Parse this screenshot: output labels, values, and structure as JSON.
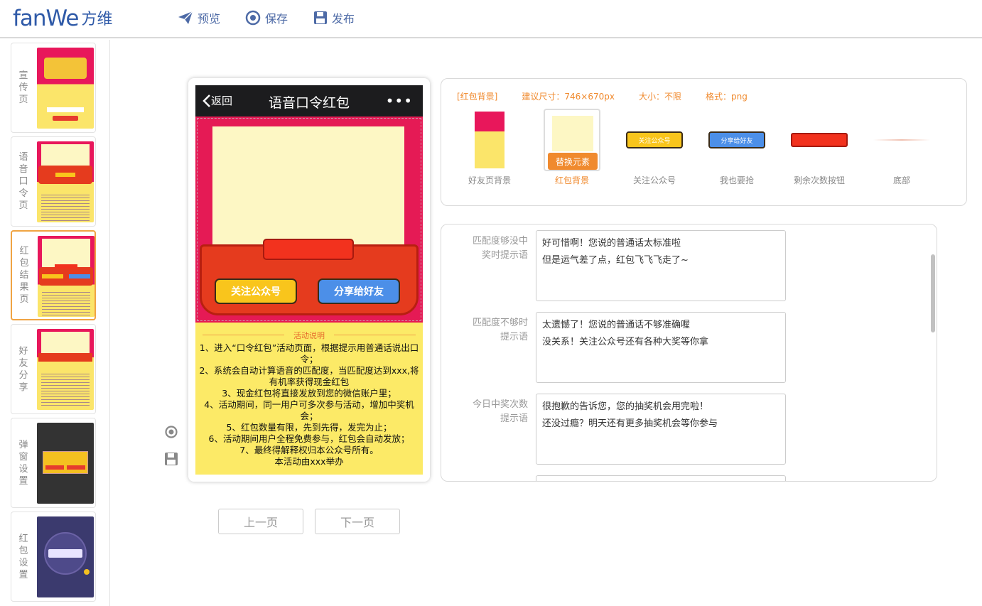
{
  "app": {
    "logo_en": "fanWe",
    "logo_cn": "方维"
  },
  "toolbar": {
    "preview": "预览",
    "save": "保存",
    "publish": "发布"
  },
  "sidebar": {
    "pages": [
      {
        "label": "宣\n传\n页"
      },
      {
        "label": "语\n音\n口\n令\n页"
      },
      {
        "label": "红\n包\n结\n果\n页"
      },
      {
        "label": "好\n友\n分\n享"
      },
      {
        "label": "弹\n窗\n设\n置"
      },
      {
        "label": "红\n包\n设\n置"
      }
    ]
  },
  "phone": {
    "back": "返回",
    "title": "语音口令红包",
    "more": "•••",
    "follow_btn": "关注公众号",
    "share_btn": "分享给好友",
    "rules_title": "活动说明",
    "rules": [
      "1、进入“口令红包”活动页面，根据提示用普通话说出口令；",
      "2、系统会自动计算语音的匹配度，当匹配度达到xxx,将有机率获得现金红包",
      "3、现金红包将直接发放到您的微信账户里；",
      "4、活动期间，同一用户可多次参与活动，增加中奖机会；",
      "5、红包数量有限，先到先得，发完为止；",
      "6、活动期间用户全程免费参与，红包会自动发放；",
      "7、最终得解释权归本公众号所有。",
      "本活动由xxx举办"
    ]
  },
  "nav": {
    "prev": "上一页",
    "next": "下一页"
  },
  "assets": {
    "info": {
      "tag": "[红包背景]",
      "size": "建议尺寸：746×670px",
      "filesize": "大小：不限",
      "format": "格式：png"
    },
    "replace_label": "替换元素",
    "items": [
      {
        "caption": "好友页背景"
      },
      {
        "caption": "红包背景"
      },
      {
        "caption": "关注公众号",
        "btn_text": "关注公众号"
      },
      {
        "caption": "我也要抢",
        "btn_text": "分享给好友"
      },
      {
        "caption": "剩余次数按钮"
      },
      {
        "caption": "底部"
      }
    ]
  },
  "messages": [
    {
      "label": "匹配度够没中\n奖时提示语",
      "text": "好可惜啊！您说的普通话太标准啦\n但是运气差了点，红包飞飞飞走了~"
    },
    {
      "label": "匹配度不够时\n提示语",
      "text": "太遗憾了！您说的普通话不够准确喔\n没关系！关注公众号还有各种大奖等你拿"
    },
    {
      "label": "今日中奖次数\n提示语",
      "text": "很抱歉的告诉您，您的抽奖机会用完啦！\n还没过瘾？明天还有更多抽奖机会等你参与"
    },
    {
      "label": "",
      "text": ""
    }
  ],
  "colors": {
    "accent": "#f08a2e",
    "brand": "#2f5aa8",
    "toolbar": "#4d6aa6"
  }
}
